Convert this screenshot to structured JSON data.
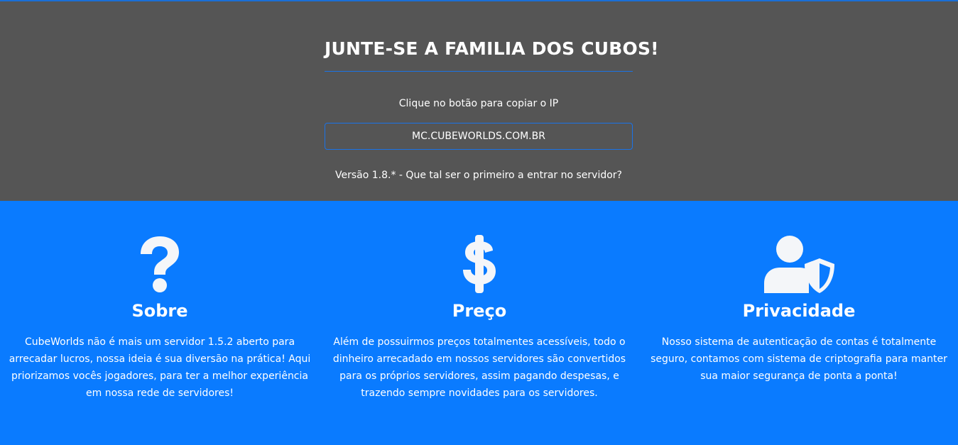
{
  "hero": {
    "title": "JUNTE-SE A FAMILIA DOS CUBOS!",
    "subtitle": "Clique no botão para copiar o IP",
    "ip_button": "MC.CUBEWORLDS.COM.BR",
    "version": "Versão 1.8.* - Que tal ser o primeiro a entrar no servidor?"
  },
  "features": [
    {
      "icon": "question-icon",
      "title": "Sobre",
      "text": "CubeWorlds não é mais um servidor 1.5.2 aberto para arrecadar lucros, nossa ideia é sua diversão na prática! Aqui priorizamos vocês jogadores, para ter a melhor experiência em nossa rede de servidores!"
    },
    {
      "icon": "dollar-icon",
      "title": "Preço",
      "text": "Além de possuirmos preços totalmentes acessíveis, todo o dinheiro arrecadado em nossos servidores são convertidos para os próprios servidores, assim pagando despesas, e trazendo sempre novidades para os servidores."
    },
    {
      "icon": "user-shield-icon",
      "title": "Privacidade",
      "text": "Nosso sistema de autenticação de contas é totalmente seguro, contamos com sistema de criptografia para manter sua maior segurança de ponta a ponta!"
    }
  ],
  "colors": {
    "hero_bg": "#555555",
    "accent": "#1a73e8",
    "features_bg": "#0a7bff",
    "icon": "#f4f6f9"
  }
}
